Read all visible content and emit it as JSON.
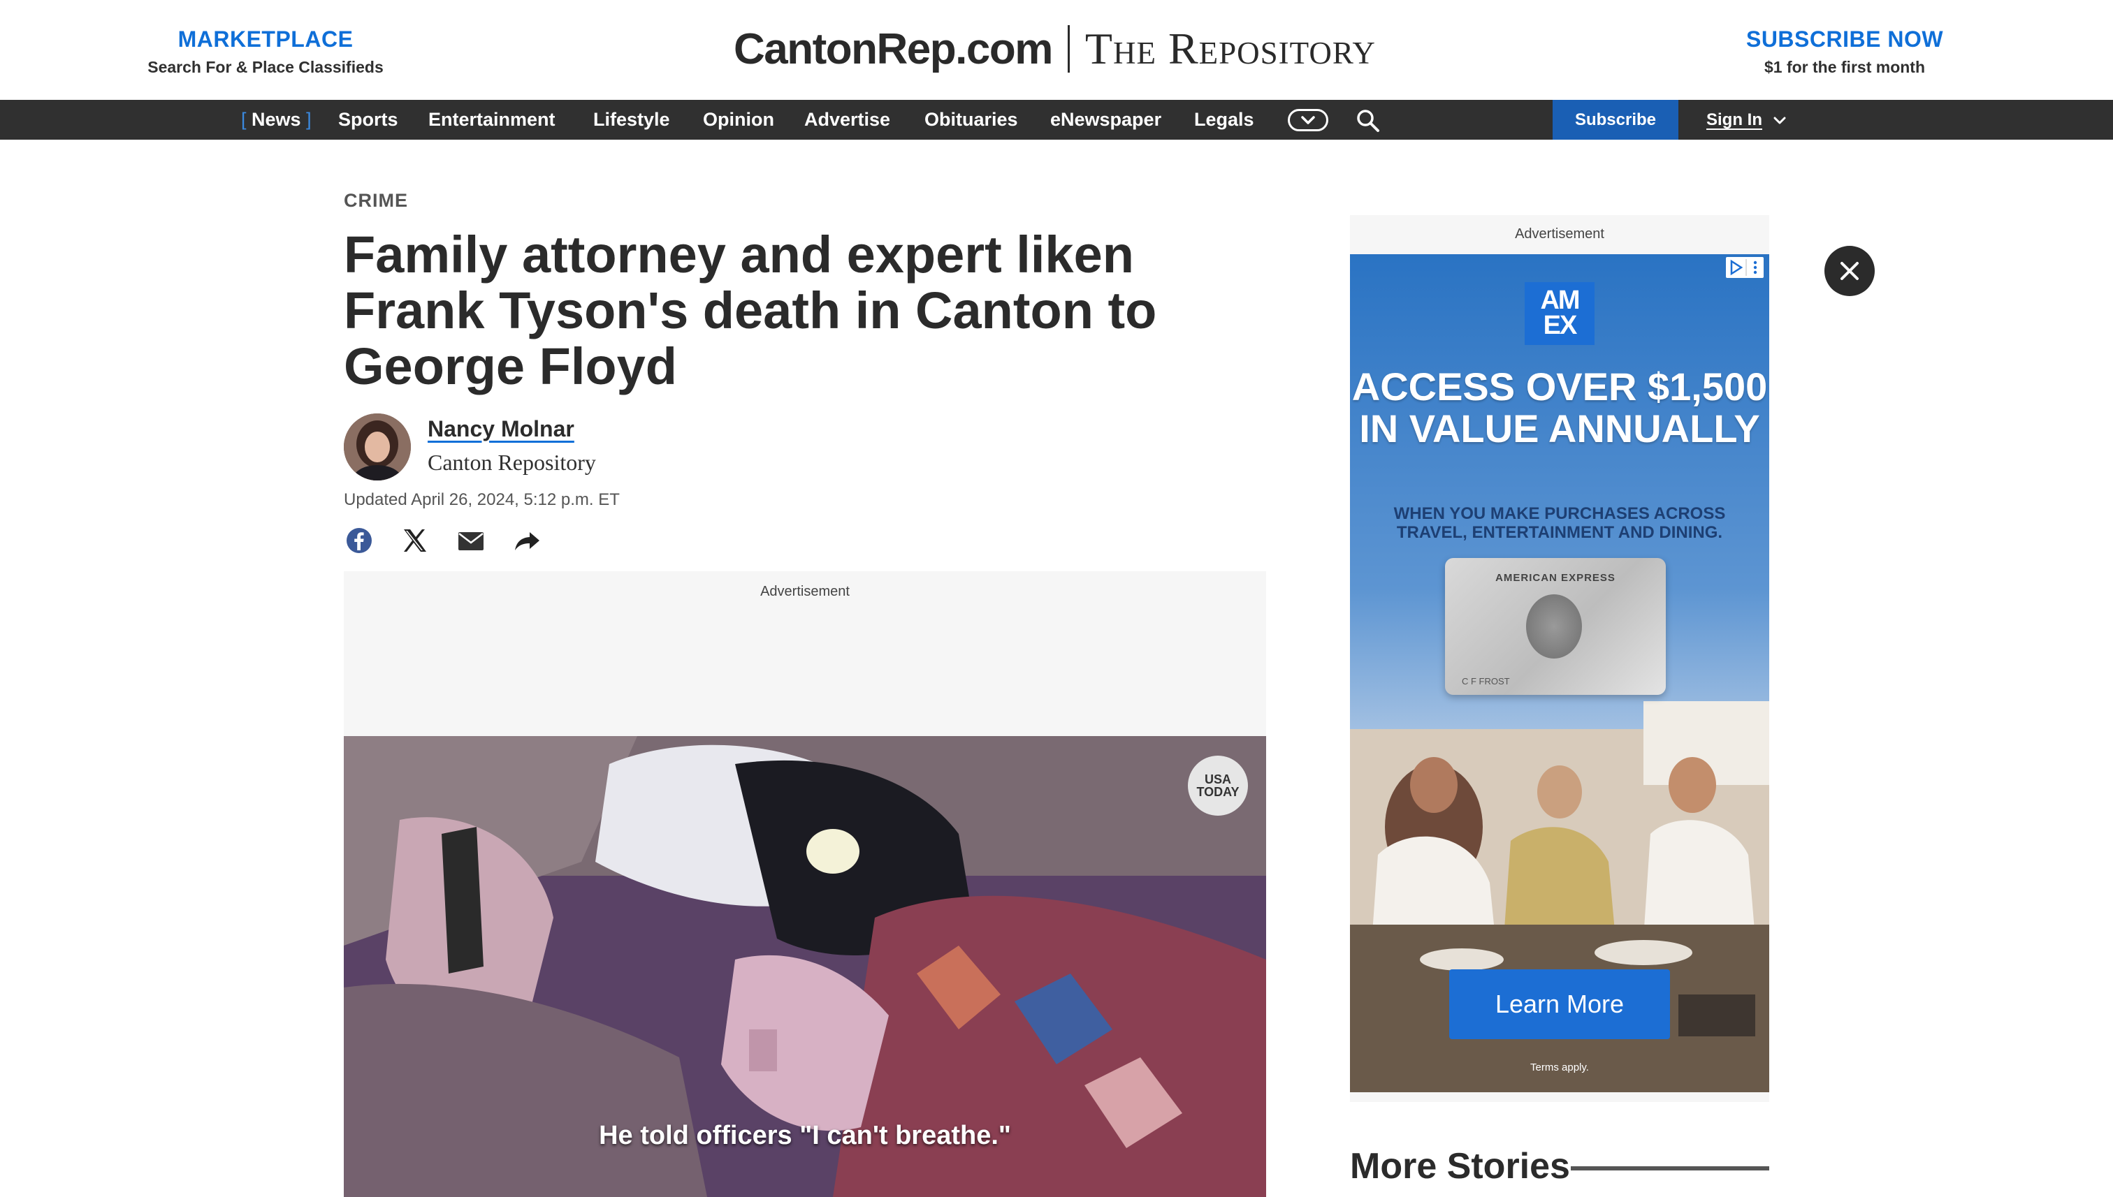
{
  "masthead": {
    "marketplace_title": "MARKETPLACE",
    "marketplace_sub": "Search For & Place Classifieds",
    "logo_left": "CantonRep.com",
    "logo_right": "The Repository",
    "subscribe_title": "SUBSCRIBE NOW",
    "subscribe_sub": "$1 for the first month"
  },
  "nav": {
    "items": [
      "News",
      "Sports",
      "Entertainment",
      "Lifestyle",
      "Opinion",
      "Advertise",
      "Obituaries",
      "eNewspaper",
      "Legals"
    ],
    "active": "News",
    "subscribe": "Subscribe",
    "signin": "Sign In"
  },
  "article": {
    "section": "CRIME",
    "headline": "Family attorney and expert liken Frank Tyson's death in Canton to George Floyd",
    "author": "Nancy Molnar",
    "organization": "Canton Repository",
    "updated": "Updated April 26, 2024, 5:12 p.m. ET",
    "ad_label": "Advertisement",
    "video_caption": "He told officers \"I can't breathe.\"",
    "video_badge": "USA TODAY"
  },
  "sidebar": {
    "ad_label": "Advertisement",
    "amex_logo": "AM EX",
    "ad_headline": "ACCESS OVER $1,500 IN VALUE ANNUALLY",
    "ad_sub": "WHEN YOU MAKE PURCHASES ACROSS TRAVEL, ENTERTAINMENT AND DINING.",
    "card_title": "AMERICAN EXPRESS",
    "card_name": "C F FROST",
    "cta": "Learn More",
    "terms": "Terms apply.",
    "more_stories": "More Stories"
  },
  "colors": {
    "accent": "#0f6fd8",
    "navbar": "#303030",
    "subscribe_button": "#1a5fb4"
  }
}
